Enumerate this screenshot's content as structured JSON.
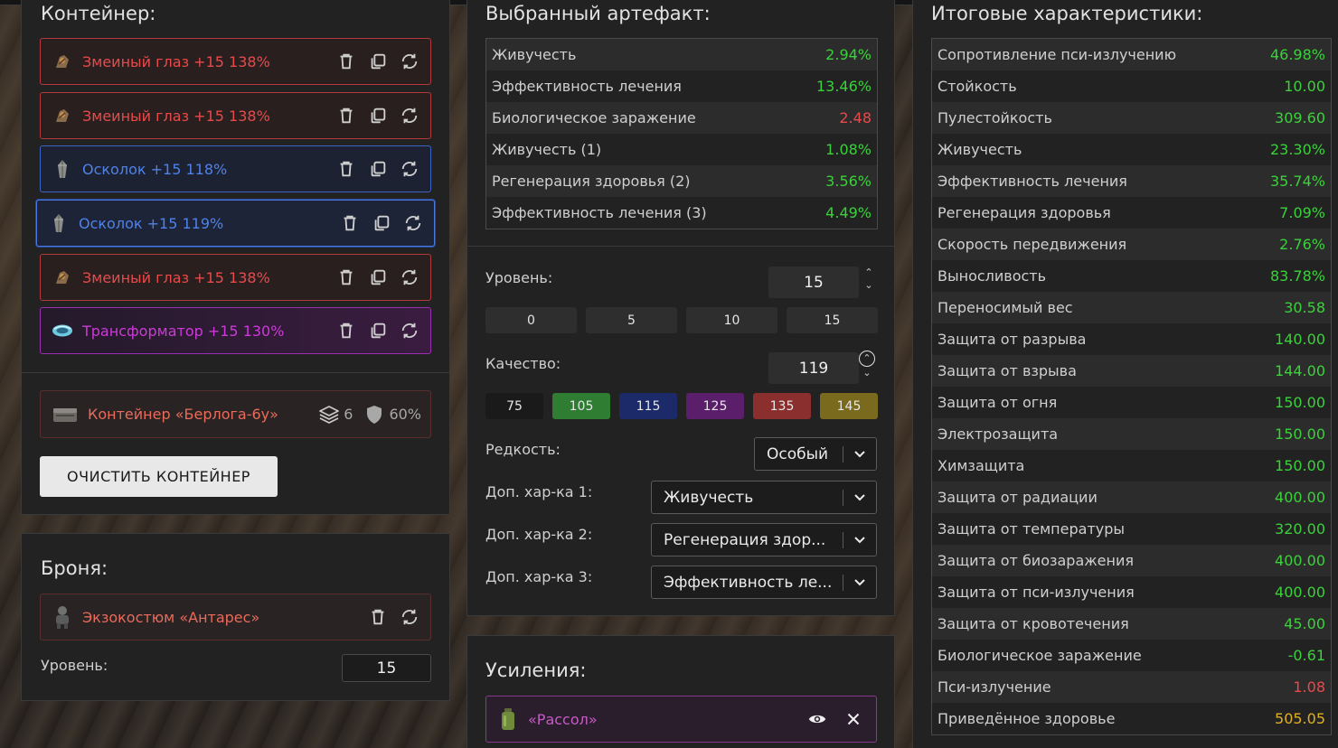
{
  "container_panel": {
    "title": "Контейнер:",
    "artifacts": [
      {
        "name": "Змеиный глаз +15 138%",
        "color": "red",
        "icon": "snake-eye-icon"
      },
      {
        "name": "Змеиный глаз +15 138%",
        "color": "red",
        "icon": "snake-eye-icon"
      },
      {
        "name": "Осколок +15 118%",
        "color": "blue",
        "icon": "shard-icon"
      },
      {
        "name": "Осколок +15 119%",
        "color": "blue",
        "icon": "shard-icon",
        "selected": true
      },
      {
        "name": "Змеиный глаз +15 138%",
        "color": "red",
        "icon": "snake-eye-icon"
      },
      {
        "name": "Трансформатор +15 130%",
        "color": "purple",
        "icon": "transformer-icon"
      }
    ],
    "container": {
      "name": "Контейнер «Берлога-6у»",
      "slots": "6",
      "protection": "60%"
    },
    "clear_button": "ОЧИСТИТЬ КОНТЕЙНЕР"
  },
  "armor_panel": {
    "title": "Броня:",
    "armor_name": "Экзокостюм «Антарес»",
    "level_label": "Уровень:",
    "level_value": "15"
  },
  "artifact_panel": {
    "title": "Выбранный артефакт:",
    "stats": [
      {
        "label": "Живучесть",
        "value": "2.94%",
        "color": "green"
      },
      {
        "label": "Эффективность лечения",
        "value": "13.46%",
        "color": "green"
      },
      {
        "label": "Биологическое заражение",
        "value": "2.48",
        "color": "red"
      },
      {
        "label": "Живучесть (1)",
        "value": "1.08%",
        "color": "green"
      },
      {
        "label": "Регенерация здоровья (2)",
        "value": "3.56%",
        "color": "green"
      },
      {
        "label": "Эффективность лечения (3)",
        "value": "4.49%",
        "color": "green"
      }
    ],
    "level_label": "Уровень:",
    "level_value": "15",
    "level_presets": [
      "0",
      "5",
      "10",
      "15"
    ],
    "quality_label": "Качество:",
    "quality_value": "119",
    "quality_presets": [
      {
        "label": "75",
        "color": "#1a1a1a"
      },
      {
        "label": "105",
        "color": "#2e7d32"
      },
      {
        "label": "115",
        "color": "#1c2a6a"
      },
      {
        "label": "125",
        "color": "#5a1e6a"
      },
      {
        "label": "135",
        "color": "#8a2e2e"
      },
      {
        "label": "145",
        "color": "#7a6a1e"
      }
    ],
    "rarity_label": "Редкость:",
    "rarity_value": "Особый",
    "extra1_label": "Доп. хар-ка 1:",
    "extra1_value": "Живучесть",
    "extra2_label": "Доп. хар-ка 2:",
    "extra2_value": "Регенерация здор...",
    "extra3_label": "Доп. хар-ка 3:",
    "extra3_value": "Эффективность ле..."
  },
  "boosts_panel": {
    "title": "Усиления:",
    "item_name": "«Рассол»"
  },
  "totals_panel": {
    "title": "Итоговые характеристики:",
    "stats": [
      {
        "label": "Сопротивление пси-излучению",
        "value": "46.98%",
        "color": "green"
      },
      {
        "label": "Стойкость",
        "value": "10.00",
        "color": "green"
      },
      {
        "label": "Пулестойкость",
        "value": "309.60",
        "color": "green"
      },
      {
        "label": "Живучесть",
        "value": "23.30%",
        "color": "green"
      },
      {
        "label": "Эффективность лечения",
        "value": "35.74%",
        "color": "green"
      },
      {
        "label": "Регенерация здоровья",
        "value": "7.09%",
        "color": "green"
      },
      {
        "label": "Скорость передвижения",
        "value": "2.76%",
        "color": "green"
      },
      {
        "label": "Выносливость",
        "value": "83.78%",
        "color": "green"
      },
      {
        "label": "Переносимый вес",
        "value": "30.58",
        "color": "green"
      },
      {
        "label": "Защита от разрыва",
        "value": "140.00",
        "color": "green"
      },
      {
        "label": "Защита от взрыва",
        "value": "144.00",
        "color": "green"
      },
      {
        "label": "Защита от огня",
        "value": "150.00",
        "color": "green"
      },
      {
        "label": "Электрозащита",
        "value": "150.00",
        "color": "green"
      },
      {
        "label": "Химзащита",
        "value": "150.00",
        "color": "green"
      },
      {
        "label": "Защита от радиации",
        "value": "400.00",
        "color": "green"
      },
      {
        "label": "Защита от температуры",
        "value": "320.00",
        "color": "green"
      },
      {
        "label": "Защита от биозаражения",
        "value": "400.00",
        "color": "green"
      },
      {
        "label": "Защита от пси-излучения",
        "value": "400.00",
        "color": "green"
      },
      {
        "label": "Защита от кровотечения",
        "value": "45.00",
        "color": "green"
      },
      {
        "label": "Биологическое заражение",
        "value": "-0.61",
        "color": "green"
      },
      {
        "label": "Пси-излучение",
        "value": "1.08",
        "color": "red"
      },
      {
        "label": "Приведённое здоровье",
        "value": "505.05",
        "color": "gold"
      }
    ]
  }
}
